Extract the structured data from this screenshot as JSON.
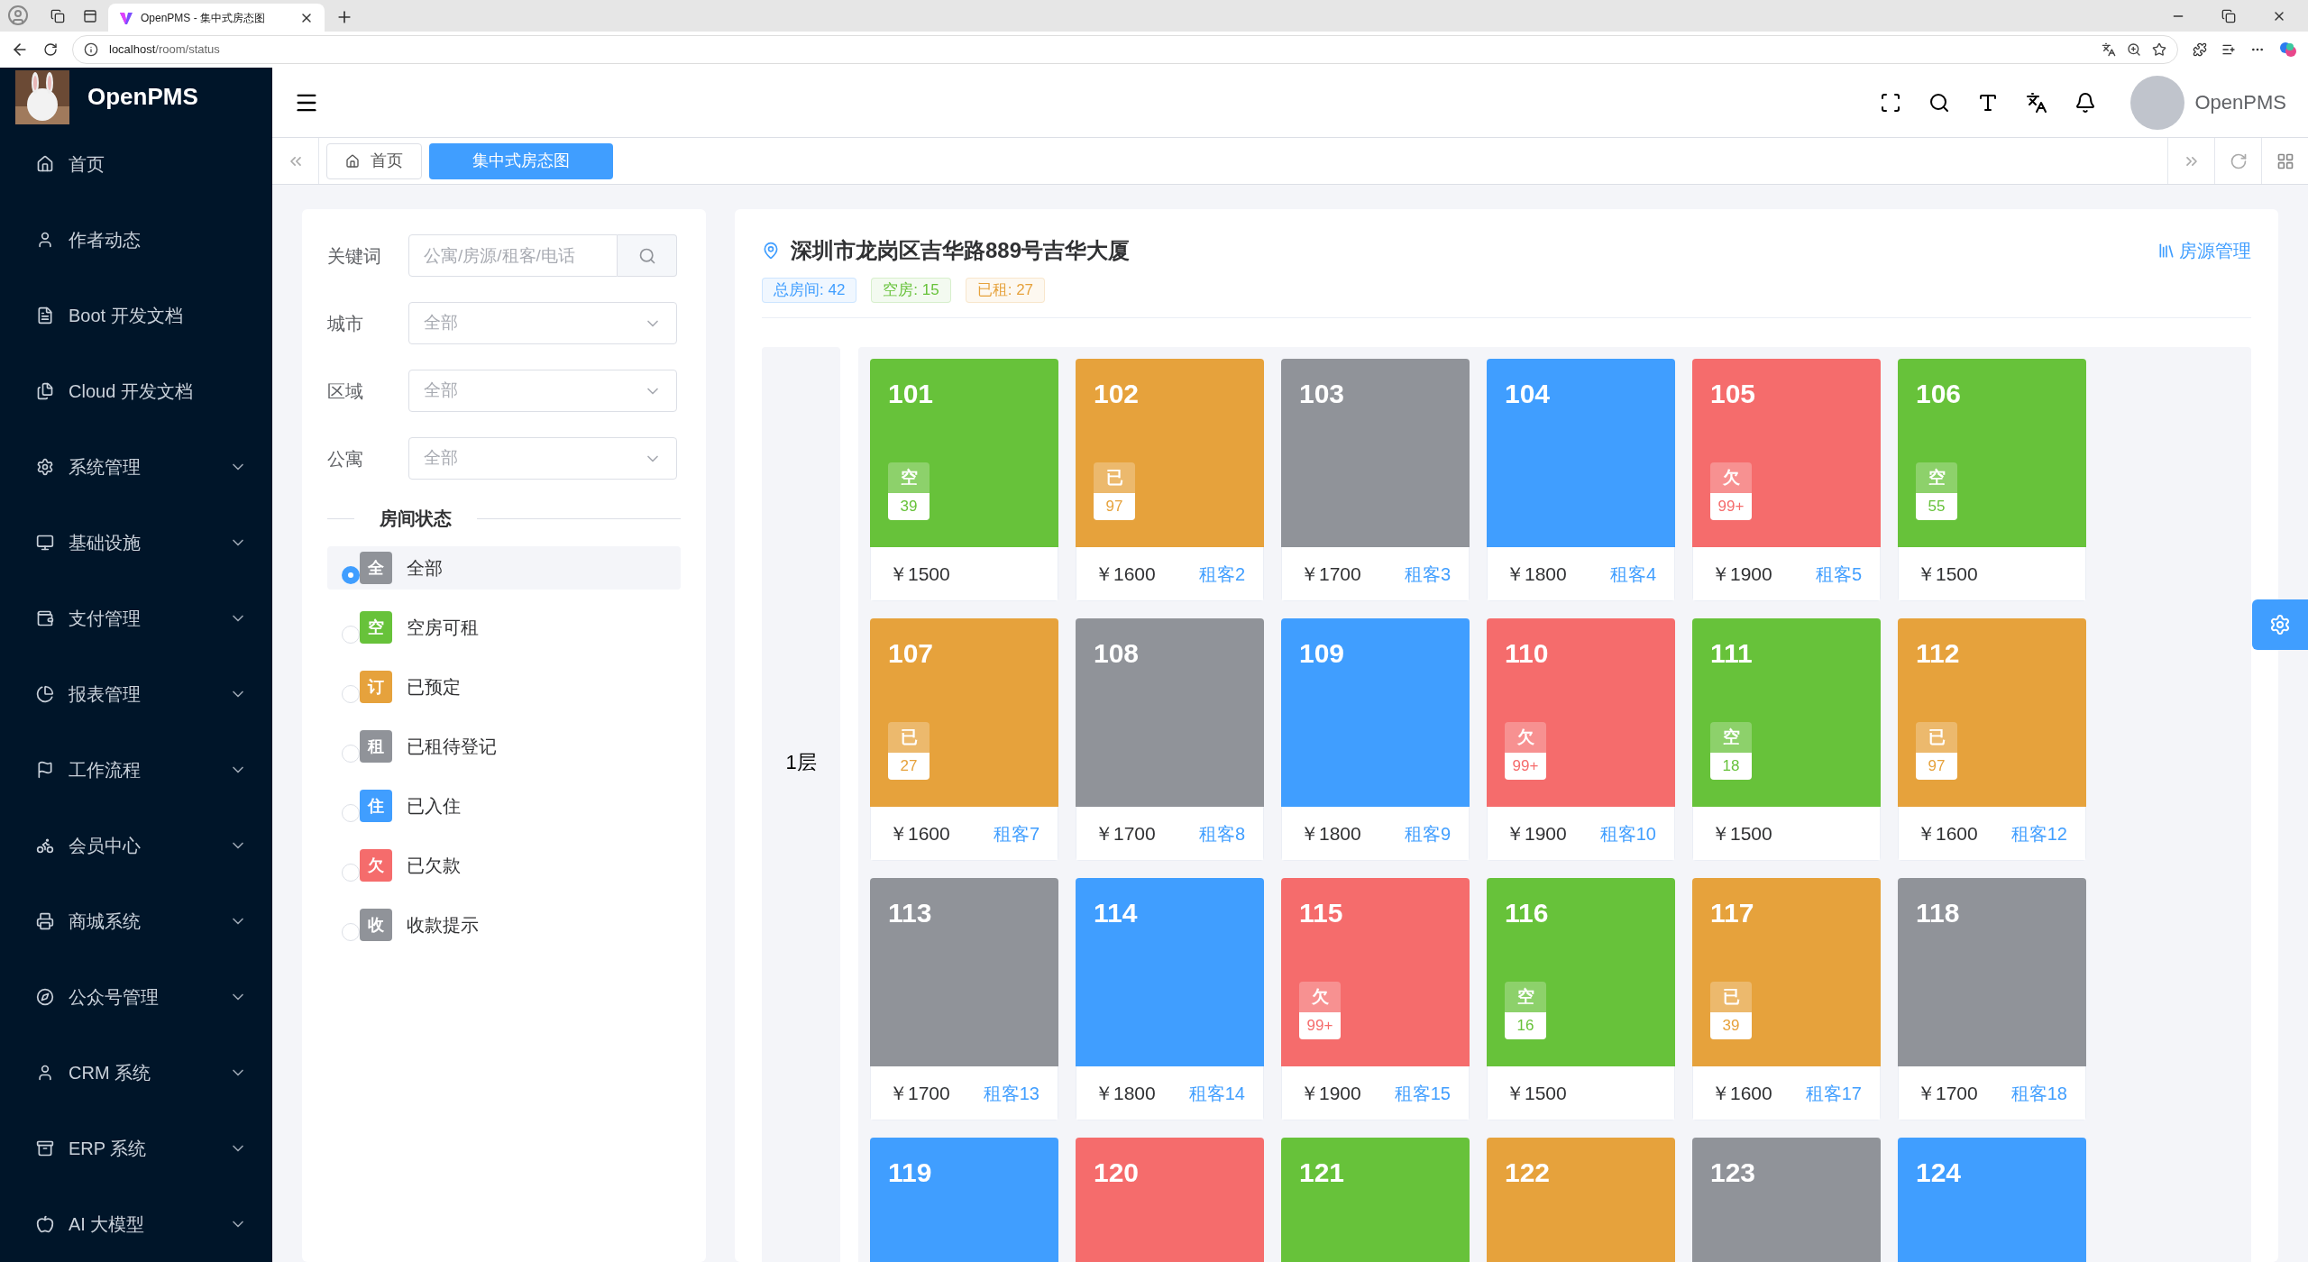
{
  "browser": {
    "tab_title": "OpenPMS - 集中式房态图",
    "url_host": "localhost",
    "url_path": "/room/status"
  },
  "sidebar": {
    "brand": "OpenPMS",
    "items": [
      {
        "label": "首页",
        "kind": "link"
      },
      {
        "label": "作者动态",
        "kind": "link"
      },
      {
        "label": "Boot 开发文档",
        "kind": "link"
      },
      {
        "label": "Cloud 开发文档",
        "kind": "link"
      },
      {
        "label": "系统管理",
        "kind": "submenu"
      },
      {
        "label": "基础设施",
        "kind": "submenu"
      },
      {
        "label": "支付管理",
        "kind": "submenu"
      },
      {
        "label": "报表管理",
        "kind": "submenu"
      },
      {
        "label": "工作流程",
        "kind": "submenu"
      },
      {
        "label": "会员中心",
        "kind": "submenu"
      },
      {
        "label": "商城系统",
        "kind": "submenu"
      },
      {
        "label": "公众号管理",
        "kind": "submenu"
      },
      {
        "label": "CRM 系统",
        "kind": "submenu"
      },
      {
        "label": "ERP 系统",
        "kind": "submenu"
      },
      {
        "label": "AI 大模型",
        "kind": "submenu"
      }
    ]
  },
  "header": {
    "user_name": "OpenPMS"
  },
  "tabs": [
    {
      "label": "首页",
      "selected": false
    },
    {
      "label": "集中式房态图",
      "selected": true
    }
  ],
  "filters": {
    "keyword": {
      "label": "关键词",
      "placeholder": "公寓/房源/租客/电话"
    },
    "selects": [
      {
        "label": "城市",
        "value": "全部"
      },
      {
        "label": "区域",
        "value": "全部"
      },
      {
        "label": "公寓",
        "value": "全部"
      }
    ],
    "status_title": "房间状态",
    "statuses": [
      {
        "badge": "全",
        "label": "全部",
        "color": "#909399",
        "selected": true
      },
      {
        "badge": "空",
        "label": "空房可租",
        "color": "#67c23a",
        "selected": false
      },
      {
        "badge": "订",
        "label": "已预定",
        "color": "#e6a23c",
        "selected": false
      },
      {
        "badge": "租",
        "label": "已租待登记",
        "color": "#909399",
        "selected": false
      },
      {
        "badge": "住",
        "label": "已入住",
        "color": "#409eff",
        "selected": false
      },
      {
        "badge": "欠",
        "label": "已欠款",
        "color": "#f56c6c",
        "selected": false
      },
      {
        "badge": "收",
        "label": "收款提示",
        "color": "#909399",
        "selected": false
      }
    ]
  },
  "building": {
    "address": "深圳市龙岗区吉华路889号吉华大厦",
    "manage_link": "房源管理",
    "stats": [
      {
        "label": "总房间: 42",
        "color": "#409eff"
      },
      {
        "label": "空房: 15",
        "color": "#67c23a"
      },
      {
        "label": "已租: 27",
        "color": "#e6a23c"
      }
    ],
    "floors": [
      {
        "label": "1层",
        "rooms": [
          {
            "number": "101",
            "color": "#67c23a",
            "badge": {
              "text": "空",
              "count": "39"
            },
            "price": "￥1500"
          },
          {
            "number": "102",
            "color": "#e6a23c",
            "badge": {
              "text": "已",
              "count": "97"
            },
            "price": "￥1600",
            "tenant": "租客2"
          },
          {
            "number": "103",
            "color": "#909399",
            "price": "￥1700",
            "tenant": "租客3"
          },
          {
            "number": "104",
            "color": "#409eff",
            "price": "￥1800",
            "tenant": "租客4"
          },
          {
            "number": "105",
            "color": "#f56c6c",
            "badge": {
              "text": "欠",
              "count": "99+"
            },
            "price": "￥1900",
            "tenant": "租客5"
          },
          {
            "number": "106",
            "color": "#67c23a",
            "badge": {
              "text": "空",
              "count": "55"
            },
            "price": "￥1500"
          },
          {
            "number": "107",
            "color": "#e6a23c",
            "badge": {
              "text": "已",
              "count": "27"
            },
            "price": "￥1600",
            "tenant": "租客7"
          },
          {
            "number": "108",
            "color": "#909399",
            "price": "￥1700",
            "tenant": "租客8"
          },
          {
            "number": "109",
            "color": "#409eff",
            "price": "￥1800",
            "tenant": "租客9"
          },
          {
            "number": "110",
            "color": "#f56c6c",
            "badge": {
              "text": "欠",
              "count": "99+"
            },
            "price": "￥1900",
            "tenant": "租客10"
          },
          {
            "number": "111",
            "color": "#67c23a",
            "badge": {
              "text": "空",
              "count": "18"
            },
            "price": "￥1500"
          },
          {
            "number": "112",
            "color": "#e6a23c",
            "badge": {
              "text": "已",
              "count": "97"
            },
            "price": "￥1600",
            "tenant": "租客12"
          },
          {
            "number": "113",
            "color": "#909399",
            "price": "￥1700",
            "tenant": "租客13"
          },
          {
            "number": "114",
            "color": "#409eff",
            "price": "￥1800",
            "tenant": "租客14"
          },
          {
            "number": "115",
            "color": "#f56c6c",
            "badge": {
              "text": "欠",
              "count": "99+"
            },
            "price": "￥1900",
            "tenant": "租客15"
          },
          {
            "number": "116",
            "color": "#67c23a",
            "badge": {
              "text": "空",
              "count": "16"
            },
            "price": "￥1500"
          },
          {
            "number": "117",
            "color": "#e6a23c",
            "badge": {
              "text": "已",
              "count": "39"
            },
            "price": "￥1600",
            "tenant": "租客17"
          },
          {
            "number": "118",
            "color": "#909399",
            "price": "￥1700",
            "tenant": "租客18"
          },
          {
            "number": "119",
            "color": "#409eff"
          },
          {
            "number": "120",
            "color": "#f56c6c"
          },
          {
            "number": "121",
            "color": "#67c23a"
          },
          {
            "number": "122",
            "color": "#e6a23c"
          },
          {
            "number": "123",
            "color": "#909399"
          },
          {
            "number": "124",
            "color": "#409eff"
          }
        ]
      }
    ]
  }
}
